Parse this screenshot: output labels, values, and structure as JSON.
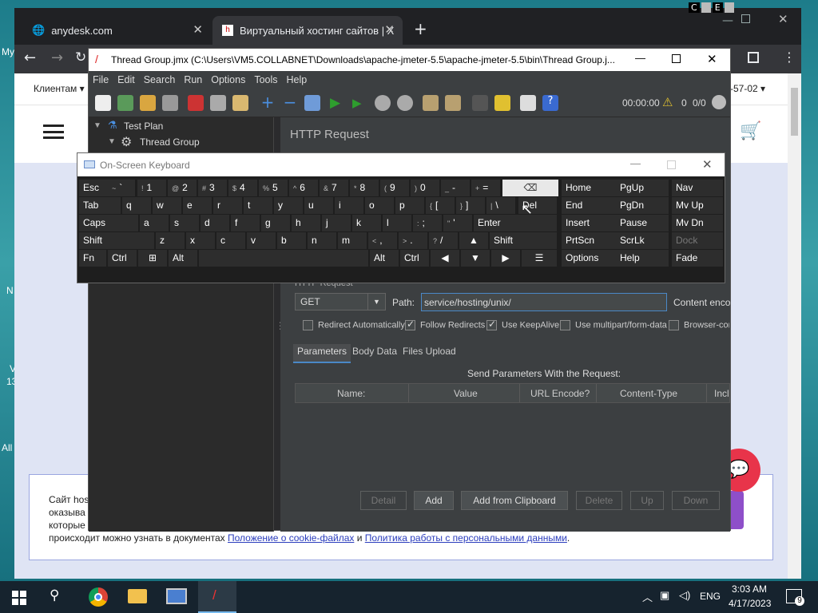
{
  "desktop": {
    "labels": [
      "My",
      "N",
      "V",
      "13",
      "All"
    ]
  },
  "anydesk": {
    "buttons": [
      "C",
      "E"
    ]
  },
  "browser": {
    "tabs": [
      {
        "title": "anydesk.com"
      },
      {
        "title": "Виртуальный хостинг сайтов | Х"
      }
    ],
    "new_tab": "+",
    "nav_left": "Клиентам ▾",
    "nav_right": "-57-02 ▾",
    "cookie": {
      "line1": "Сайт hos",
      "line2": "оказыва",
      "line3": "которые",
      "line4_prefix": "происходит можно узнать в документах",
      "link1": "Положение о cookie-файлах",
      "and": "и",
      "link2": "Политика работы с персональными данными",
      "suffix": "."
    }
  },
  "jmeter": {
    "title": "Thread Group.jmx (C:\\Users\\VM5.COLLABNET\\Downloads\\apache-jmeter-5.5\\apache-jmeter-5.5\\bin\\Thread Group.j...",
    "menu": [
      "File",
      "Edit",
      "Search",
      "Run",
      "Options",
      "Tools",
      "Help"
    ],
    "timer": "00:00:00",
    "warnings": "0",
    "threads": "0/0",
    "tree": {
      "test_plan": "Test Plan",
      "thread_group": "Thread Group"
    },
    "panel_title": "HTTP Request",
    "section": "HTTP Request",
    "method": "GET",
    "path_label": "Path:",
    "path_value": "service/hosting/unix/",
    "content_enc": "Content enco",
    "checkboxes": [
      {
        "label": "Redirect Automatically",
        "checked": false
      },
      {
        "label": "Follow Redirects",
        "checked": true
      },
      {
        "label": "Use KeepAlive",
        "checked": true
      },
      {
        "label": "Use multipart/form-data",
        "checked": false
      },
      {
        "label": "Browser-com",
        "checked": false
      }
    ],
    "tabs": [
      "Parameters",
      "Body Data",
      "Files Upload"
    ],
    "send_params": "Send Parameters With the Request:",
    "columns": [
      "Name:",
      "Value",
      "URL Encode?",
      "Content-Type",
      "Incl"
    ],
    "buttons": {
      "detail": "Detail",
      "add": "Add",
      "add_clip": "Add from Clipboard",
      "delete": "Delete",
      "up": "Up",
      "down": "Down"
    }
  },
  "osk": {
    "title": "On-Screen Keyboard",
    "keys": {
      "esc": "Esc",
      "tilde_s": "~",
      "tilde": "`",
      "n1s": "!",
      "n1": "1",
      "n2s": "@",
      "n2": "2",
      "n3s": "#",
      "n3": "3",
      "n4s": "$",
      "n4": "4",
      "n5s": "%",
      "n5": "5",
      "n6s": "^",
      "n6": "6",
      "n7s": "&",
      "n7": "7",
      "n8s": "*",
      "n8": "8",
      "n9s": "(",
      "n9": "9",
      "n0s": ")",
      "n0": "0",
      "minus_s": "_",
      "minus": "-",
      "eq_s": "+",
      "eq": "=",
      "tab": "Tab",
      "q": "q",
      "w": "w",
      "e": "e",
      "r": "r",
      "t": "t",
      "y": "y",
      "u": "u",
      "i": "i",
      "o": "o",
      "p": "p",
      "lb_s": "{",
      "lb": "[",
      "rb_s": "}",
      "rb": "]",
      "bs_s": "|",
      "bs": "\\",
      "del": "Del",
      "caps": "Caps",
      "a": "a",
      "s": "s",
      "d": "d",
      "f": "f",
      "g": "g",
      "h": "h",
      "j": "j",
      "k": "k",
      "l": "l",
      "sc_s": ":",
      "sc": ";",
      "qt_s": "\"",
      "qt": "'",
      "enter": "Enter",
      "shift": "Shift",
      "z": "z",
      "x": "x",
      "c": "c",
      "v": "v",
      "b": "b",
      "n": "n",
      "m": "m",
      "cm_s": "<",
      "cm": ",",
      "pd_s": ">",
      "pd": ".",
      "sl_s": "?",
      "sl": "/",
      "shift2": "Shift",
      "fn": "Fn",
      "ctrl": "Ctrl",
      "alt": "Alt",
      "alt2": "Alt",
      "ctrl2": "Ctrl",
      "home": "Home",
      "pgup": "PgUp",
      "nav": "Nav",
      "end": "End",
      "pgdn": "PgDn",
      "mvup": "Mv Up",
      "insert": "Insert",
      "pause": "Pause",
      "mvdn": "Mv Dn",
      "prtscn": "PrtScn",
      "scrlk": "ScrLk",
      "dock": "Dock",
      "options": "Options",
      "help": "Help",
      "fade": "Fade"
    }
  },
  "taskbar": {
    "lang": "ENG",
    "time": "3:03 AM",
    "date": "4/17/2023",
    "notif": "9"
  }
}
